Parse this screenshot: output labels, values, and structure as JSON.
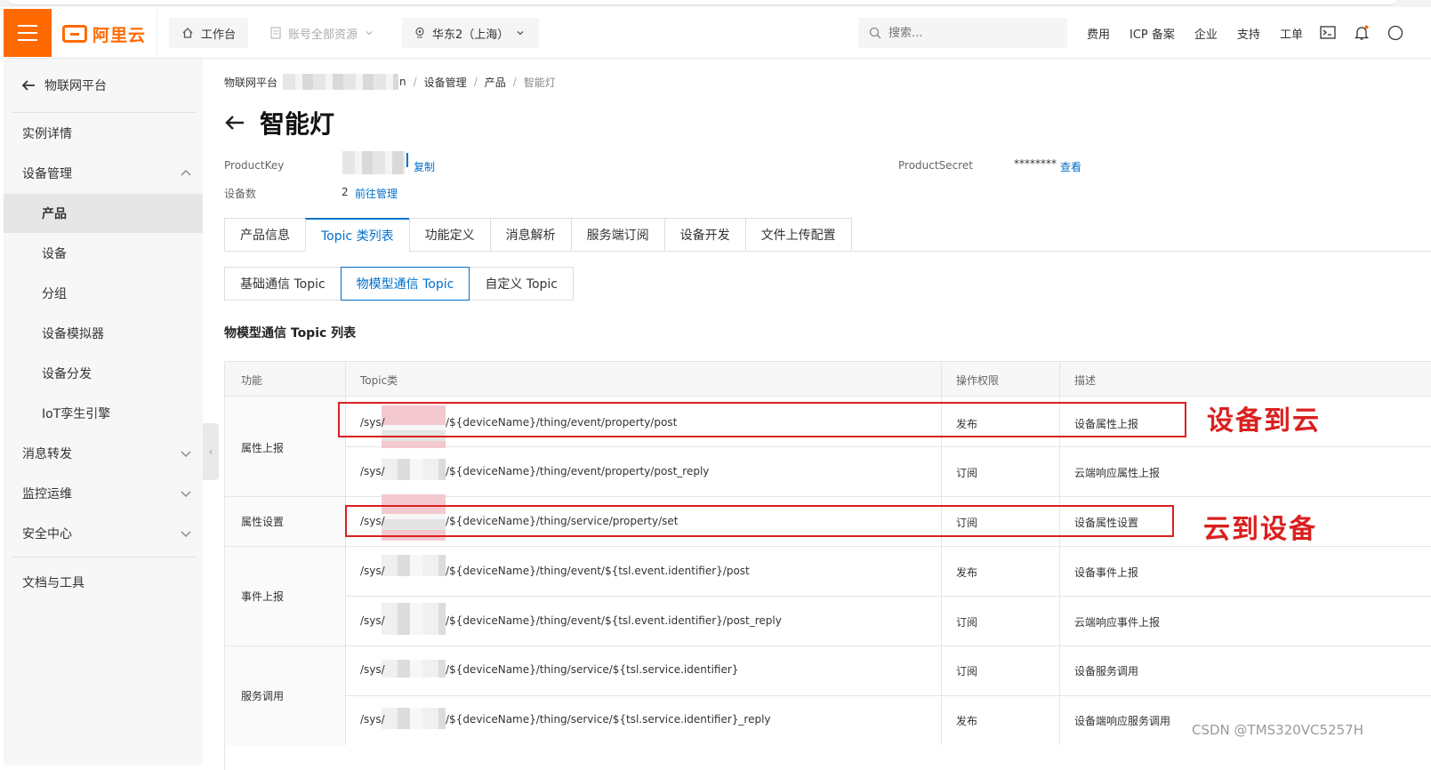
{
  "topbar": {
    "logo_text": "阿里云",
    "workbench": "工作台",
    "resources": "账号全部资源",
    "region": "华东2（上海）",
    "search_placeholder": "搜索...",
    "links": [
      "费用",
      "ICP 备案",
      "企业",
      "支持",
      "工单"
    ],
    "accent_color": "#ff6a00"
  },
  "sidebar": {
    "back_label": "物联网平台",
    "items": [
      {
        "label": "实例详情"
      },
      {
        "label": "设备管理"
      },
      {
        "label": "产品"
      },
      {
        "label": "设备"
      },
      {
        "label": "分组"
      },
      {
        "label": "设备模拟器"
      },
      {
        "label": "设备分发"
      },
      {
        "label": "IoT孪生引擎"
      },
      {
        "label": "消息转发"
      },
      {
        "label": "监控运维"
      },
      {
        "label": "安全中心"
      },
      {
        "label": "文档与工具"
      }
    ]
  },
  "breadcrumb": {
    "root": "物联网平台",
    "instance_tail": "n",
    "items": [
      "设备管理",
      "产品",
      "智能灯"
    ]
  },
  "page": {
    "title": "智能灯",
    "product_key_label": "ProductKey",
    "copy_label": "复制",
    "device_count_label": "设备数",
    "device_count": "2",
    "manage_link": "前往管理",
    "product_secret_label": "ProductSecret",
    "product_secret_value": "********",
    "view_link": "查看"
  },
  "tabs": [
    "产品信息",
    "Topic 类列表",
    "功能定义",
    "消息解析",
    "服务端订阅",
    "设备开发",
    "文件上传配置"
  ],
  "subtabs": [
    "基础通信 Topic",
    "物模型通信 Topic",
    "自定义 Topic"
  ],
  "section_title": "物模型通信 Topic 列表",
  "table": {
    "headers": [
      "功能",
      "Topic类",
      "操作权限",
      "描述"
    ],
    "groups": [
      "属性上报",
      "属性设置",
      "事件上报",
      "服务调用"
    ],
    "rows": [
      {
        "prefix": "/sys/",
        "suffix": "/${deviceName}/thing/event/property/post",
        "perm": "发布",
        "desc": "设备属性上报"
      },
      {
        "prefix": "/sys/",
        "suffix": "/${deviceName}/thing/event/property/post_reply",
        "perm": "订阅",
        "desc": "云端响应属性上报"
      },
      {
        "prefix": "/sys/",
        "suffix": "/${deviceName}/thing/service/property/set",
        "perm": "订阅",
        "desc": "设备属性设置"
      },
      {
        "prefix": "/sys/",
        "suffix": "/${deviceName}/thing/event/${tsl.event.identifier}/post",
        "perm": "发布",
        "desc": "设备事件上报"
      },
      {
        "prefix": "/sys/",
        "suffix": "/${deviceName}/thing/event/${tsl.event.identifier}/post_reply",
        "perm": "订阅",
        "desc": "云端响应事件上报"
      },
      {
        "prefix": "/sys/",
        "suffix": "/${deviceName}/thing/service/${tsl.service.identifier}",
        "perm": "订阅",
        "desc": "设备服务调用"
      },
      {
        "prefix": "/sys/",
        "suffix": "/${deviceName}/thing/service/${tsl.service.identifier}_reply",
        "perm": "发布",
        "desc": "设备端响应服务调用"
      }
    ]
  },
  "annotations": {
    "device_to_cloud": "设备到云",
    "cloud_to_device": "云到设备",
    "color": "#d9201f"
  },
  "watermark": "CSDN @TMS320VC5257H"
}
